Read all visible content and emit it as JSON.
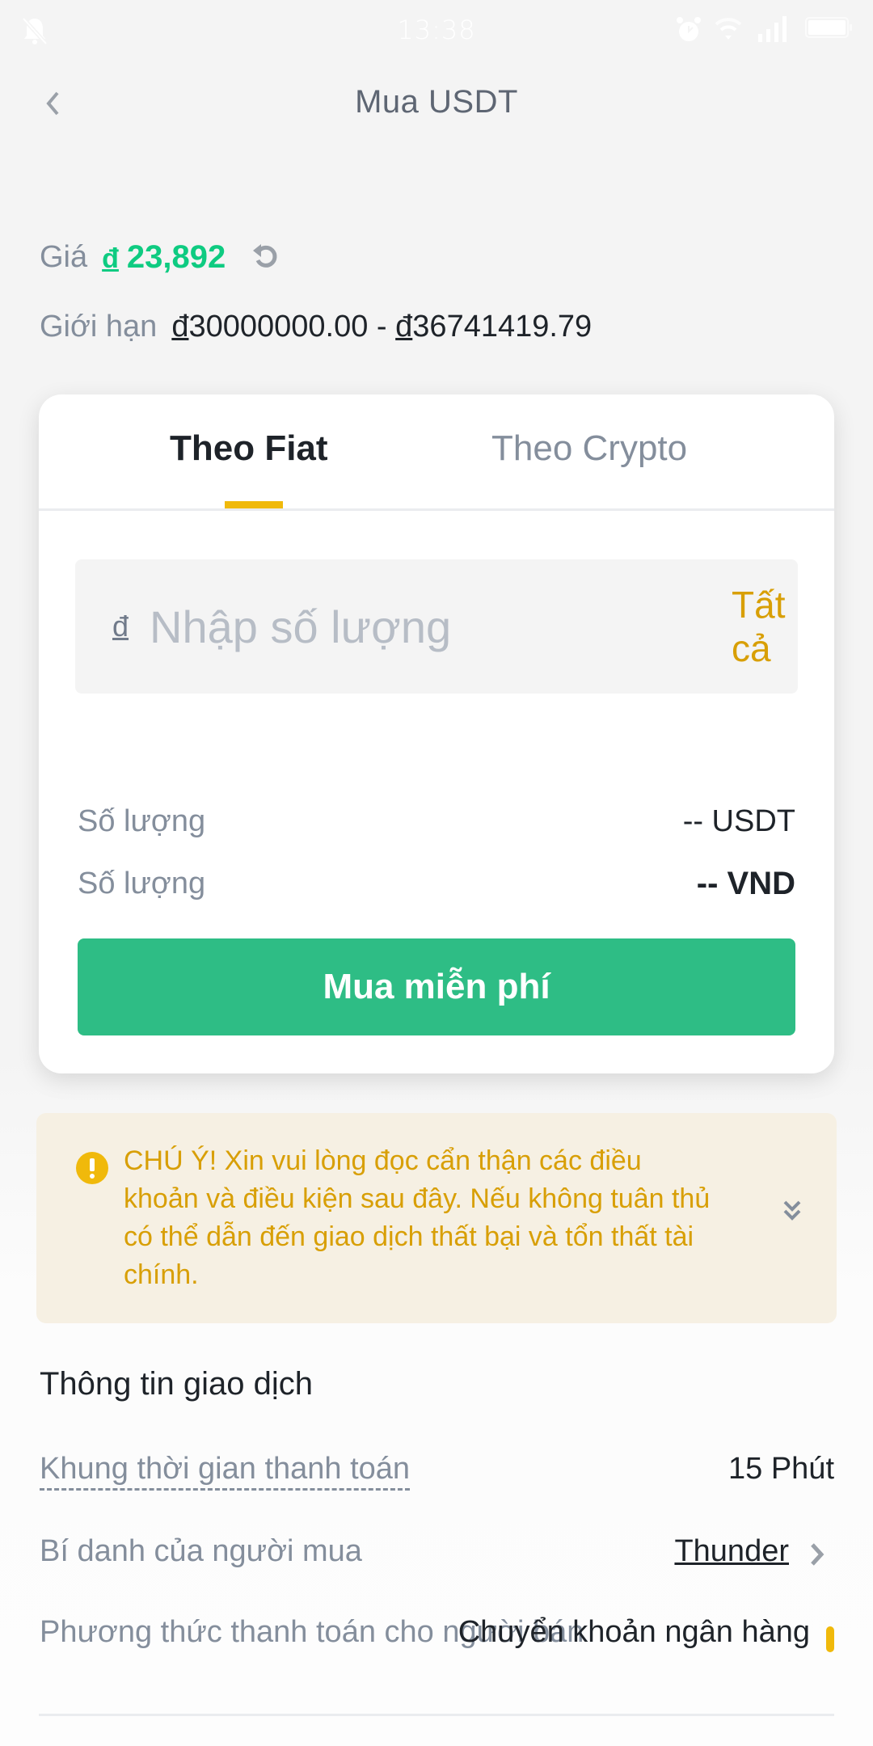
{
  "status_bar": {
    "time": "13:38",
    "icons": [
      "bell-muted-icon",
      "alarm-icon",
      "wifi-icon",
      "signal-icon",
      "battery-icon"
    ]
  },
  "header": {
    "back_icon": "chevron-left-icon",
    "title": "Mua USDT"
  },
  "price": {
    "label": "Giá",
    "currency_symbol": "đ",
    "value": "23,892",
    "refresh_icon": "refresh-icon"
  },
  "limit": {
    "label": "Giới hạn",
    "min_symbol": "đ",
    "min": "30000000.00",
    "separator": " - ",
    "max_symbol": "đ",
    "max": "36741419.79"
  },
  "card": {
    "tabs": [
      {
        "label": "Theo Fiat",
        "active": true
      },
      {
        "label": "Theo Crypto",
        "active": false
      }
    ],
    "input": {
      "currency_symbol": "đ",
      "placeholder": "Nhập số lượng",
      "value": "",
      "all_label": "Tất cả"
    },
    "summary": [
      {
        "label": "Số lượng",
        "value": "-- USDT"
      },
      {
        "label": "Số lượng",
        "value": "-- VND"
      }
    ],
    "buy_button": "Mua miễn phí"
  },
  "notice": {
    "icon": "warning-icon",
    "text": "CHÚ Ý! Xin vui lòng đọc cẩn thận các điều khoản và điều kiện sau đây. Nếu không tuân thủ có thể dẫn đến giao dịch thất bại và tổn thất tài chính.",
    "expand_icon": "double-chevron-down-icon"
  },
  "trade_info": {
    "title": "Thông tin giao dịch",
    "rows": [
      {
        "label": "Khung thời gian thanh toán",
        "value": "15 Phút"
      },
      {
        "label": "Bí danh của người mua",
        "value": "Thunder"
      },
      {
        "label": "Phương thức thanh toán cho người bán",
        "value": "Chuyển khoản ngân hàng"
      }
    ]
  },
  "colors": {
    "accent_yellow": "#f0b90b",
    "buy_green": "#2ebd85",
    "price_green": "#0ecb81",
    "notice_text": "#d89f06",
    "notice_bg": "#f6f0e3"
  }
}
